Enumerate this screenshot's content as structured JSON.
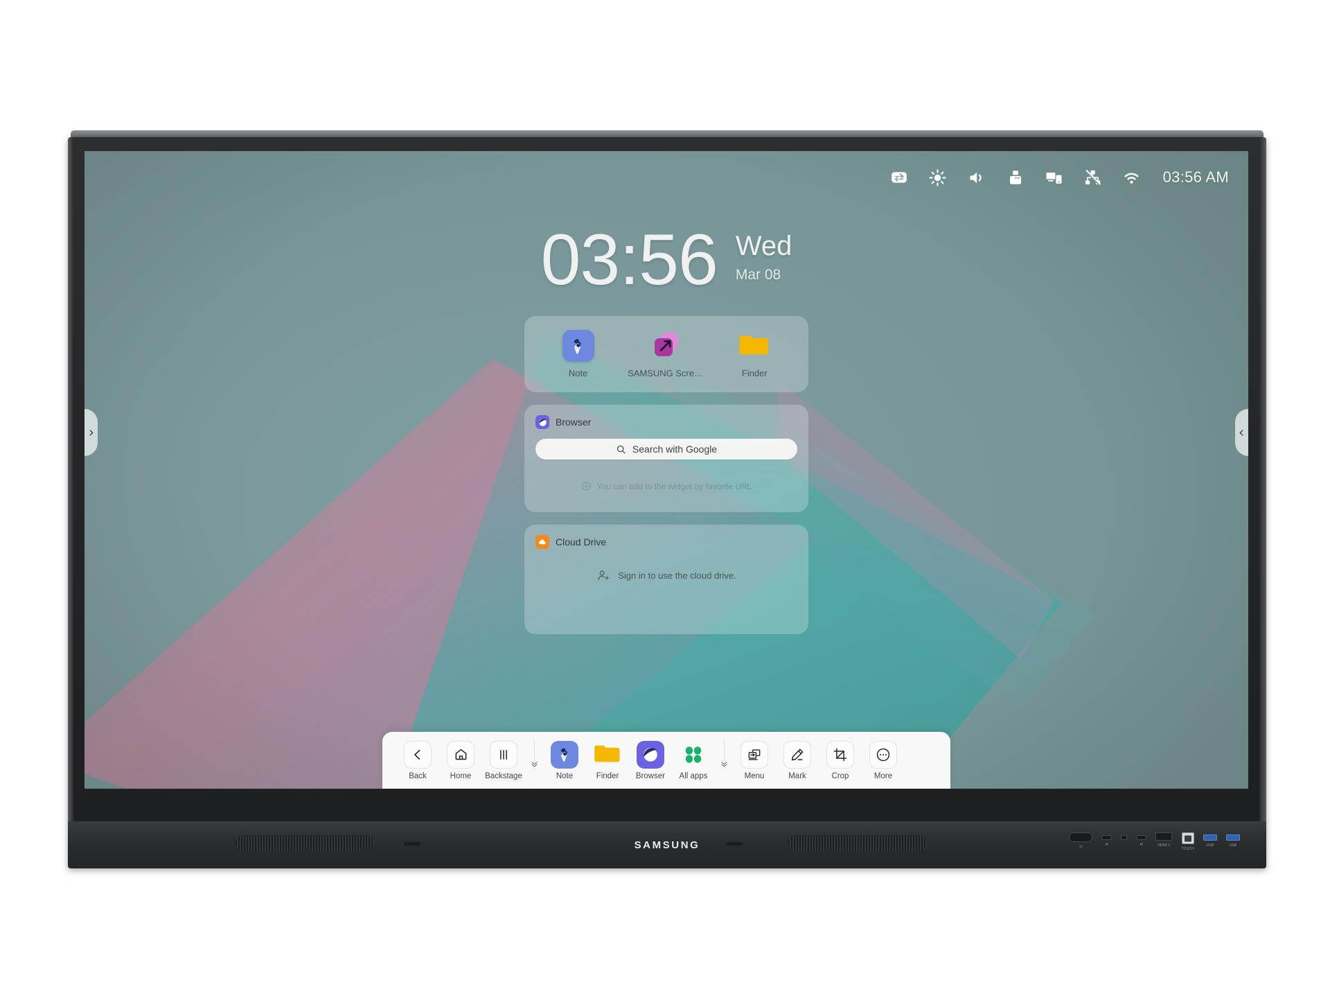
{
  "device": {
    "brand": "SAMSUNG",
    "ports": [
      {
        "name": "power-button",
        "label": "⏻",
        "type": "power"
      },
      {
        "name": "usb-c-port",
        "label": "⇄",
        "type": "usbc"
      },
      {
        "name": "aux-port",
        "label": "",
        "type": "dot"
      },
      {
        "name": "usb-c-port-2",
        "label": "⇄",
        "type": "usbc2"
      },
      {
        "name": "hdmi-port",
        "label": "HDMI 1",
        "type": "hdmi"
      },
      {
        "name": "touch-port",
        "label": "TOUCH",
        "type": "touch"
      },
      {
        "name": "usb-port-1",
        "label": "USB",
        "type": "usb"
      },
      {
        "name": "usb-port-2",
        "label": "USB",
        "type": "usb"
      }
    ]
  },
  "statusbar": {
    "icons": [
      {
        "name": "input-source-icon",
        "label": "input-source"
      },
      {
        "name": "brightness-icon",
        "label": "brightness"
      },
      {
        "name": "volume-icon",
        "label": "volume"
      },
      {
        "name": "usb-device-icon",
        "label": "usb-device"
      },
      {
        "name": "screen-share-icon",
        "label": "screen-share"
      },
      {
        "name": "network-disconnected-icon",
        "label": "network-disconnected"
      },
      {
        "name": "wifi-icon",
        "label": "wifi"
      }
    ],
    "time": "03:56 AM"
  },
  "clock": {
    "time": "03:56",
    "day": "Wed",
    "date": "Mar 08"
  },
  "shortcuts": {
    "items": [
      {
        "label": "Note",
        "icon": "note-icon"
      },
      {
        "label": "SAMSUNG Screen…",
        "icon": "samsung-screen-icon"
      },
      {
        "label": "Finder",
        "icon": "finder-folder-icon"
      }
    ]
  },
  "browser_widget": {
    "title": "Browser",
    "icon": "browser-icon",
    "search_placeholder": "Search with Google",
    "hint": "You can add to the widget by favorite URL"
  },
  "cloud_widget": {
    "title": "Cloud Drive",
    "icon": "cloud-drive-icon",
    "message": "Sign in to use the cloud drive."
  },
  "handles": {
    "left": "chevron-right-icon",
    "right": "chevron-left-icon"
  },
  "taskbar": {
    "nav": [
      {
        "label": "Back",
        "icon": "back-chevron-icon"
      },
      {
        "label": "Home",
        "icon": "home-icon"
      },
      {
        "label": "Backstage",
        "icon": "backstage-bars-icon"
      }
    ],
    "apps": [
      {
        "label": "Note",
        "icon": "note-icon"
      },
      {
        "label": "Finder",
        "icon": "finder-folder-icon"
      },
      {
        "label": "Browser",
        "icon": "browser-icon"
      },
      {
        "label": "All apps",
        "icon": "all-apps-grid-icon"
      }
    ],
    "tools": [
      {
        "label": "Menu",
        "icon": "menu-windows-icon"
      },
      {
        "label": "Mark",
        "icon": "pen-mark-icon"
      },
      {
        "label": "Crop",
        "icon": "crop-icon"
      },
      {
        "label": "More",
        "icon": "more-dots-icon"
      }
    ],
    "collapse_icon": "double-chevron-down-icon"
  },
  "colors": {
    "wallpaper": "#7d9a9c",
    "note_blue": "#6e88e0",
    "folder_yellow": "#f5b700",
    "screen_purple": "#a83aa0",
    "browser_purple": "#6a62e0",
    "allapps_green": "#17b26a",
    "cloud_orange": "#f08a1e",
    "taskbar_bg": "#f7f8f7"
  }
}
